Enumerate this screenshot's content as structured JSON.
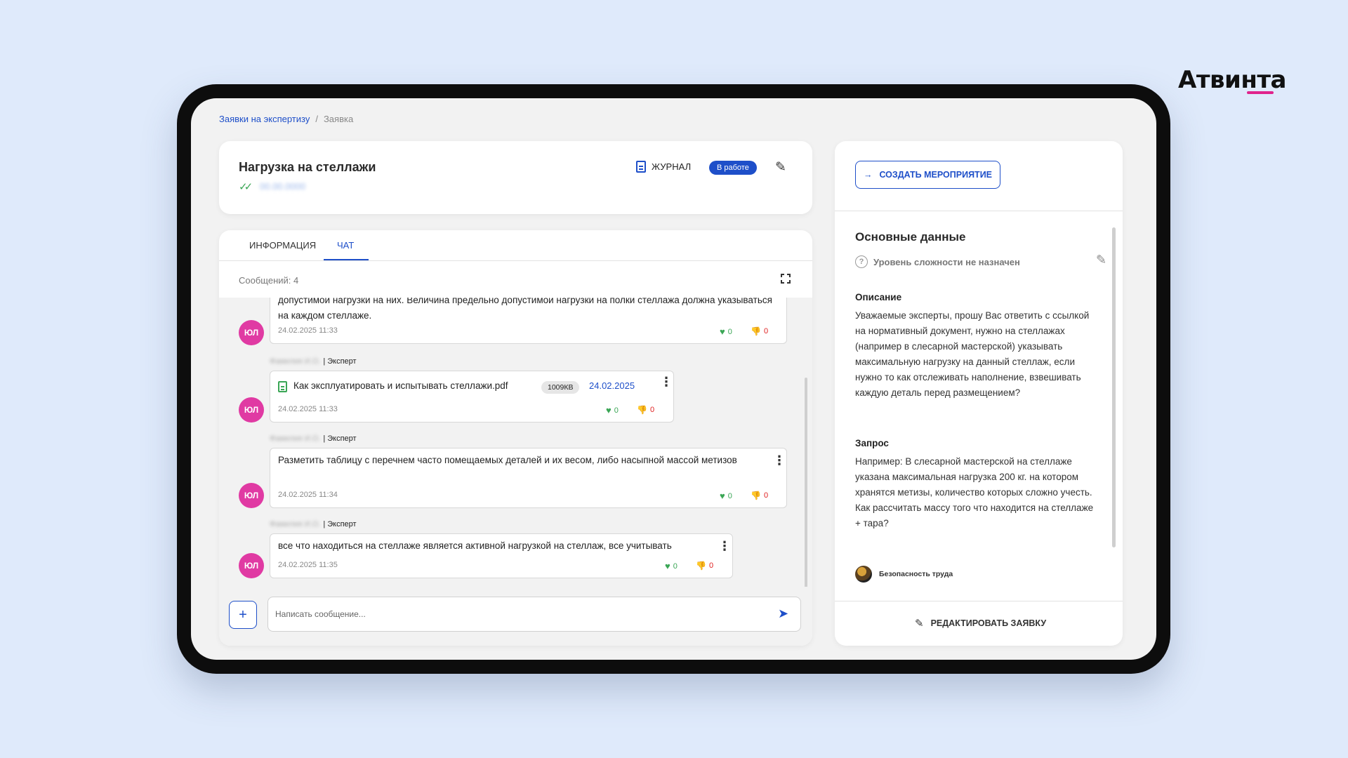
{
  "brand": "Атвинта",
  "breadcrumb": {
    "parent": "Заявки на экспертизу",
    "separator": "/",
    "current": "Заявка"
  },
  "header": {
    "title": "Нагрузка на стеллажи",
    "date_blurred": "00.00.0000",
    "journal_label": "ЖУРНАЛ",
    "status": "В работе"
  },
  "tabs": {
    "info": "ИНФОРМАЦИЯ",
    "chat": "ЧАТ"
  },
  "chat": {
    "count_label": "Сообщений: 4",
    "messages": [
      {
        "avatar": "ЮЛ",
        "text": "допустимой нагрузки на них. Величина предельно допустимой нагрузки на полки стеллажа должна указываться на каждом стеллаже.",
        "time": "24.02.2025 11:33",
        "likes": "0",
        "dislikes": "0"
      },
      {
        "author": "Фамилия И.О.",
        "role": "| Эксперт",
        "avatar": "ЮЛ",
        "file_name": "Как эксплуатировать и испытывать стеллажи.pdf",
        "file_size": "1009КВ",
        "file_date": "24.02.2025",
        "time": "24.02.2025 11:33",
        "likes": "0",
        "dislikes": "0"
      },
      {
        "author": "Фамилия И.О.",
        "role": "| Эксперт",
        "avatar": "ЮЛ",
        "text": "Разметить таблицу с перечнем часто помещаемых деталей и их весом, либо насыпной массой метизов",
        "time": "24.02.2025 11:34",
        "likes": "0",
        "dislikes": "0"
      },
      {
        "author": "Фамилия И.О.",
        "role": "| Эксперт",
        "avatar": "ЮЛ",
        "text": "все что находиться на стеллаже является активной нагрузкой на стеллаж, все учитывать",
        "time": "24.02.2025 11:35",
        "likes": "0",
        "dislikes": "0"
      }
    ],
    "input_placeholder": "Написать сообщение...",
    "attach_label": "+"
  },
  "side": {
    "create_label": "СОЗДАТЬ МЕРОПРИЯТИЕ",
    "title": "Основные данные",
    "complexity": "Уровень сложности не назначен",
    "description_label": "Описание",
    "description": "Уважаемые эксперты, прошу Вас ответить с ссылкой на нормативный документ, нужно на стеллажах (например в слесарной мастерской) указывать максимальную нагрузку на данный стеллаж, если нужно то как отслеживать наполнение, взвешивать каждую деталь перед размещением?",
    "request_label": "Запрос",
    "request": "Например: В слесарной мастерской на стеллаже указана максимальная нагрузка 200 кг. на котором хранятся метизы, количество которых сложно учесть. Как рассчитать массу того что находится на стеллаже + тара?",
    "tag": "Безопасность труда",
    "edit_label": "РЕДАКТИРОВАТЬ ЗАЯВКУ"
  },
  "icons": [
    "double-check-icon",
    "journal-doc-icon",
    "pencil-icon",
    "fullscreen-icon",
    "heart-icon",
    "thumb-down-icon",
    "more-vertical-icon",
    "pdf-file-icon",
    "plus-icon",
    "send-icon",
    "arrow-right-icon",
    "question-circle-icon"
  ],
  "colors": {
    "accent": "#1e4fc9",
    "avatar": "#e03aa3",
    "like": "#3aa655",
    "dislike": "#e02020",
    "brand_underline": "#e0238c"
  }
}
